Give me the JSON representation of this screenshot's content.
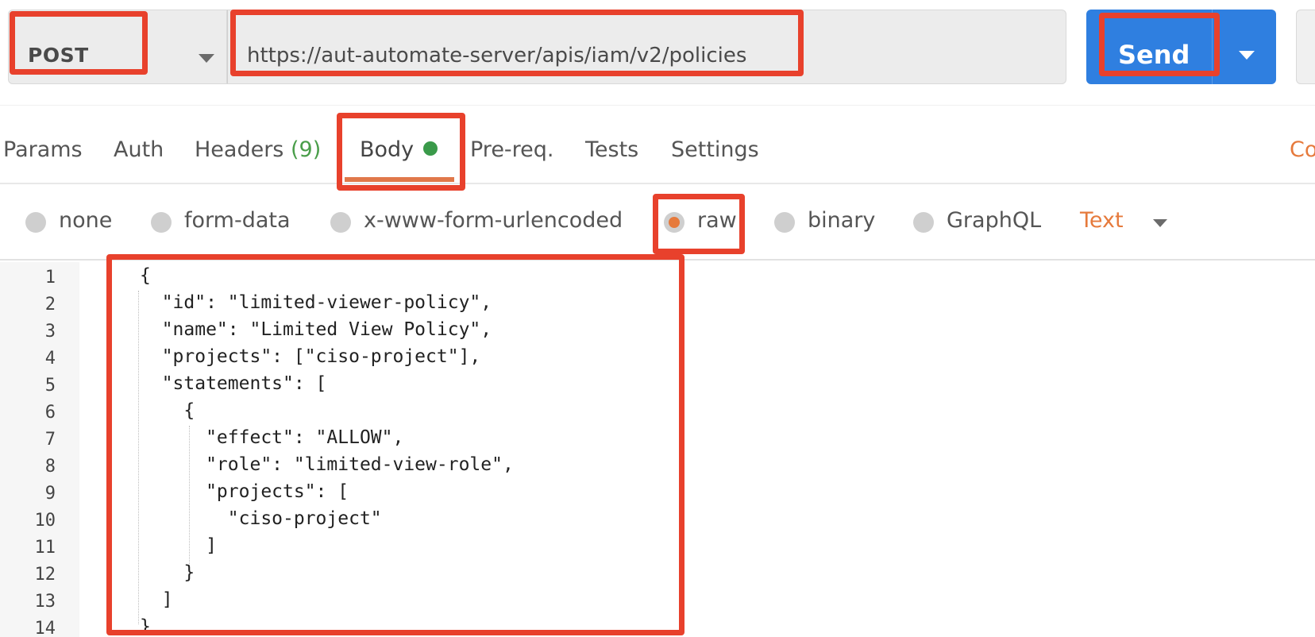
{
  "request": {
    "method": "POST",
    "url": "https://aut-automate-server/apis/iam/v2/policies",
    "send_label": "Send"
  },
  "tabs": [
    {
      "label": "Params"
    },
    {
      "label": "Auth"
    },
    {
      "label": "Headers",
      "count": "(9)"
    },
    {
      "label": "Body",
      "active": true
    },
    {
      "label": "Pre-req."
    },
    {
      "label": "Tests"
    },
    {
      "label": "Settings"
    }
  ],
  "cookies_label": "Co",
  "body_types": [
    {
      "label": "none"
    },
    {
      "label": "form-data"
    },
    {
      "label": "x-www-form-urlencoded"
    },
    {
      "label": "raw",
      "selected": true
    },
    {
      "label": "binary"
    },
    {
      "label": "GraphQL"
    }
  ],
  "format": "Text",
  "editor": {
    "lines": [
      {
        "num": "1",
        "text": "{"
      },
      {
        "num": "2",
        "text": "  \"id\": \"limited-viewer-policy\","
      },
      {
        "num": "3",
        "text": "  \"name\": \"Limited View Policy\","
      },
      {
        "num": "4",
        "text": "  \"projects\": [\"ciso-project\"],"
      },
      {
        "num": "5",
        "text": "  \"statements\": ["
      },
      {
        "num": "6",
        "text": "    {"
      },
      {
        "num": "7",
        "text": "      \"effect\": \"ALLOW\","
      },
      {
        "num": "8",
        "text": "      \"role\": \"limited-view-role\","
      },
      {
        "num": "9",
        "text": "      \"projects\": ["
      },
      {
        "num": "10",
        "text": "        \"ciso-project\""
      },
      {
        "num": "11",
        "text": "      ]"
      },
      {
        "num": "12",
        "text": "    }"
      },
      {
        "num": "13",
        "text": "  ]"
      },
      {
        "num": "14",
        "text": "}"
      }
    ]
  },
  "colors": {
    "send_button": "#2f7fe0",
    "accent_orange": "#e67a3c",
    "body_indicator": "#3a9a4a",
    "highlight_red": "#e8412c"
  }
}
